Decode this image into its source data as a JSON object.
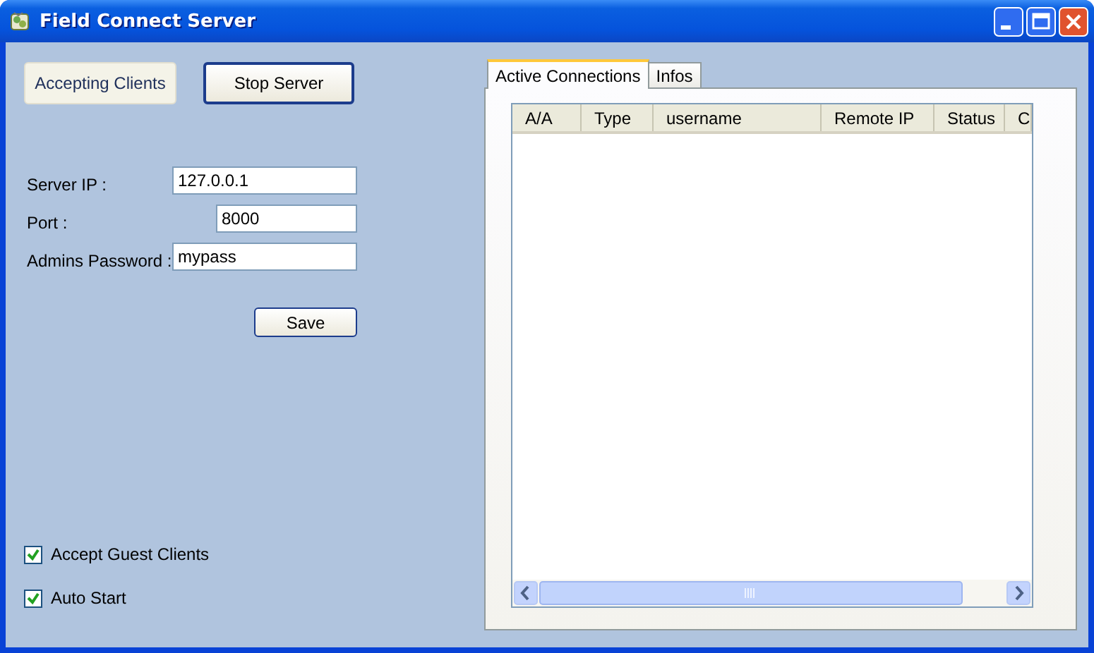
{
  "window": {
    "title": "Field Connect Server"
  },
  "status_button": {
    "label": "Accepting Clients"
  },
  "stop_button": {
    "label": "Stop Server"
  },
  "fields": [
    {
      "label": "Server IP :",
      "value": "127.0.0.1",
      "kind": "wide"
    },
    {
      "label": "Port :",
      "value": "8000",
      "kind": "short"
    },
    {
      "label": "Admins Password :",
      "value": "mypass",
      "kind": "wide"
    }
  ],
  "save_button": {
    "label": "Save"
  },
  "checkboxes": [
    {
      "label": "Accept Guest Clients",
      "checked": true
    },
    {
      "label": "Auto Start",
      "checked": true
    }
  ],
  "tabs": [
    {
      "label": "Active Connections",
      "selected": true
    },
    {
      "label": "Infos",
      "selected": false
    }
  ],
  "table": {
    "columns": [
      "A/A",
      "Type",
      "username",
      "Remote IP",
      "Status",
      "C"
    ]
  }
}
